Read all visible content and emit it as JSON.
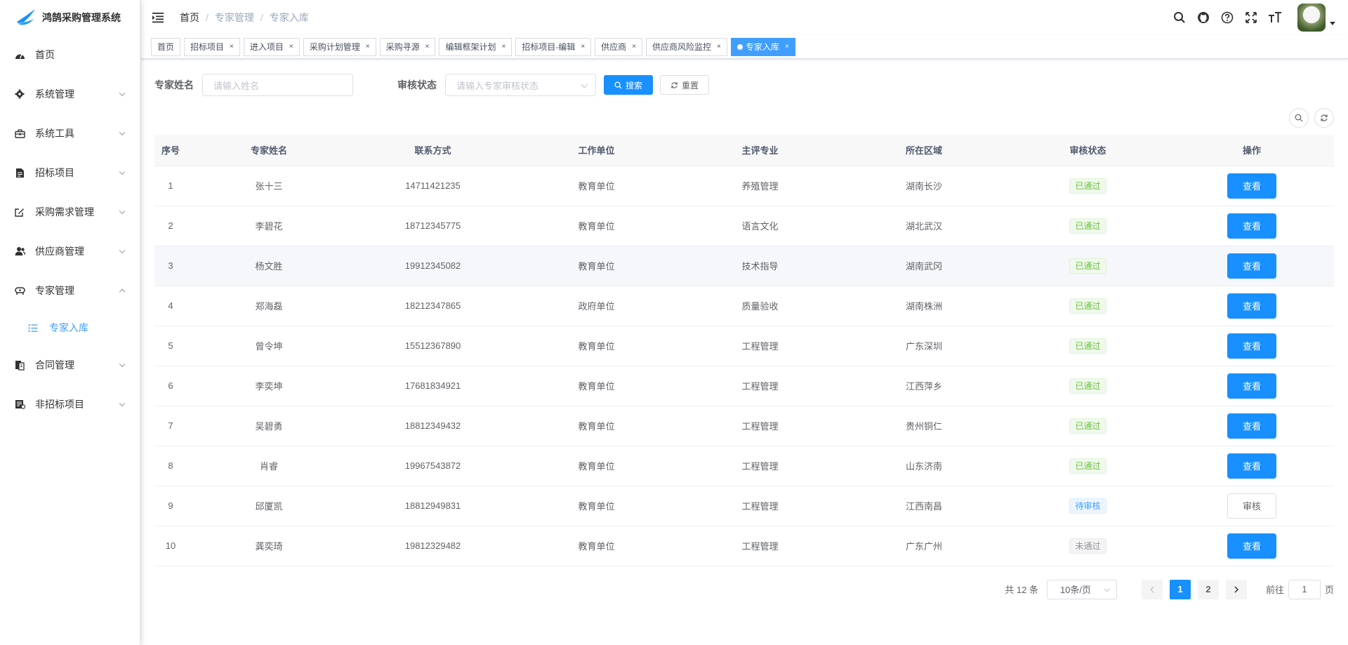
{
  "app": {
    "title": "鸿鹄采购管理系统",
    "accent": "#1890ff"
  },
  "sidebar": {
    "items": [
      {
        "label": "首页",
        "icon": "dashboard-icon"
      },
      {
        "label": "系统管理",
        "icon": "gear-icon"
      },
      {
        "label": "系统工具",
        "icon": "toolbox-icon"
      },
      {
        "label": "招标项目",
        "icon": "document-icon"
      },
      {
        "label": "采购需求管理",
        "icon": "edit-icon"
      },
      {
        "label": "供应商管理",
        "icon": "users-icon"
      },
      {
        "label": "专家管理",
        "icon": "expert-icon"
      },
      {
        "label": "合同管理",
        "icon": "contract-icon"
      },
      {
        "label": "非招标项目",
        "icon": "form-icon"
      }
    ],
    "sub_item": {
      "label": "专家入库",
      "icon": "list-icon"
    }
  },
  "header": {
    "breadcrumb": [
      "首页",
      "专家管理",
      "专家入库"
    ]
  },
  "tags": [
    {
      "label": "首页",
      "closable": false
    },
    {
      "label": "招标项目",
      "closable": true
    },
    {
      "label": "进入项目",
      "closable": true
    },
    {
      "label": "采购计划管理",
      "closable": true
    },
    {
      "label": "采购寻源",
      "closable": true
    },
    {
      "label": "编辑框架计划",
      "closable": true
    },
    {
      "label": "招标项目-编辑",
      "closable": true
    },
    {
      "label": "供应商",
      "closable": true
    },
    {
      "label": "供应商风险监控",
      "closable": true
    },
    {
      "label": "专家入库",
      "closable": true,
      "active": true
    }
  ],
  "search": {
    "name_label": "专家姓名",
    "name_placeholder": "请输入姓名",
    "status_label": "审核状态",
    "status_placeholder": "请输入专家审核状态",
    "search_button": "搜索",
    "reset_button": "重置"
  },
  "table": {
    "columns": [
      "序号",
      "专家姓名",
      "联系方式",
      "工作单位",
      "主评专业",
      "所在区域",
      "审核状态",
      "操作"
    ],
    "rows": [
      {
        "no": "1",
        "name": "张十三",
        "phone": "14711421235",
        "unit": "教育单位",
        "major": "养殖管理",
        "area": "湖南长沙",
        "status": "已通过",
        "status_type": "pass",
        "action": "查看",
        "action_type": "primary"
      },
      {
        "no": "2",
        "name": "李碧花",
        "phone": "18712345775",
        "unit": "教育单位",
        "major": "语言文化",
        "area": "湖北武汉",
        "status": "已通过",
        "status_type": "pass",
        "action": "查看",
        "action_type": "primary"
      },
      {
        "no": "3",
        "name": "杨文胜",
        "phone": "19912345082",
        "unit": "教育单位",
        "major": "技术指导",
        "area": "湖南武冈",
        "status": "已通过",
        "status_type": "pass",
        "action": "查看",
        "action_type": "primary"
      },
      {
        "no": "4",
        "name": "郑海磊",
        "phone": "18212347865",
        "unit": "政府单位",
        "major": "质量验收",
        "area": "湖南株洲",
        "status": "已通过",
        "status_type": "pass",
        "action": "查看",
        "action_type": "primary"
      },
      {
        "no": "5",
        "name": "曾令坤",
        "phone": "15512367890",
        "unit": "教育单位",
        "major": "工程管理",
        "area": "广东深圳",
        "status": "已通过",
        "status_type": "pass",
        "action": "查看",
        "action_type": "primary"
      },
      {
        "no": "6",
        "name": "李奕坤",
        "phone": "17681834921",
        "unit": "教育单位",
        "major": "工程管理",
        "area": "江西萍乡",
        "status": "已通过",
        "status_type": "pass",
        "action": "查看",
        "action_type": "primary"
      },
      {
        "no": "7",
        "name": "吴碧勇",
        "phone": "18812349432",
        "unit": "教育单位",
        "major": "工程管理",
        "area": "贵州铜仁",
        "status": "已通过",
        "status_type": "pass",
        "action": "查看",
        "action_type": "primary"
      },
      {
        "no": "8",
        "name": "肖睿",
        "phone": "19967543872",
        "unit": "教育单位",
        "major": "工程管理",
        "area": "山东济南",
        "status": "已通过",
        "status_type": "pass",
        "action": "查看",
        "action_type": "primary"
      },
      {
        "no": "9",
        "name": "邱厦凯",
        "phone": "18812949831",
        "unit": "教育单位",
        "major": "工程管理",
        "area": "江西南昌",
        "status": "待审核",
        "status_type": "pending",
        "action": "审核",
        "action_type": "plain"
      },
      {
        "no": "10",
        "name": "龚奕琦",
        "phone": "19812329482",
        "unit": "教育单位",
        "major": "工程管理",
        "area": "广东广州",
        "status": "未通过",
        "status_type": "fail",
        "action": "查看",
        "action_type": "primary"
      }
    ]
  },
  "pagination": {
    "total": "共 12 条",
    "page_size": "10条/页",
    "pages": [
      "1",
      "2"
    ],
    "current": "1",
    "goto_label": "前往",
    "goto_value": "1",
    "page_unit": "页"
  }
}
